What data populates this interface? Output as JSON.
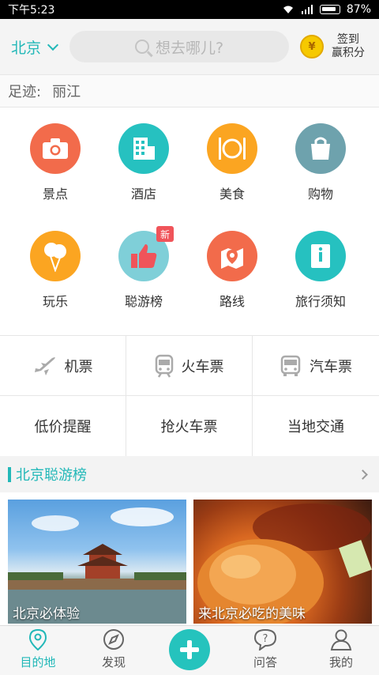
{
  "status_bar": {
    "time": "下午5:23",
    "battery": "87%"
  },
  "header": {
    "city": "北京",
    "search_placeholder": "想去哪儿?",
    "signin_line1": "签到",
    "signin_line2": "赢积分",
    "coin_symbol": "¥"
  },
  "trace": {
    "label": "足迹:",
    "place": "丽江"
  },
  "categories": [
    {
      "label": "景点",
      "color": "#f26b4b",
      "icon": "camera-icon"
    },
    {
      "label": "酒店",
      "color": "#26c1c0",
      "icon": "hotel-icon"
    },
    {
      "label": "美食",
      "color": "#fba521",
      "icon": "food-icon"
    },
    {
      "label": "购物",
      "color": "#6ea2ad",
      "icon": "shopping-bag-icon"
    },
    {
      "label": "玩乐",
      "color": "#fba521",
      "icon": "balloon-icon"
    },
    {
      "label": "聪游榜",
      "color": "#7fcfd8",
      "icon": "thumbs-up-icon",
      "badge": "新"
    },
    {
      "label": "路线",
      "color": "#f26b4b",
      "icon": "map-route-icon"
    },
    {
      "label": "旅行须知",
      "color": "#26c1c0",
      "icon": "info-book-icon"
    }
  ],
  "tickets": [
    {
      "label": "机票",
      "icon": "plane-icon"
    },
    {
      "label": "火车票",
      "icon": "train-icon"
    },
    {
      "label": "汽车票",
      "icon": "bus-icon"
    },
    {
      "label": "低价提醒"
    },
    {
      "label": "抢火车票"
    },
    {
      "label": "当地交通"
    }
  ],
  "section": {
    "title": "北京聪游榜"
  },
  "cards": [
    {
      "caption": "北京必体验"
    },
    {
      "caption": "来北京必吃的美味"
    }
  ],
  "nav": {
    "destination": "目的地",
    "discover": "发现",
    "qa": "问答",
    "mine": "我的"
  },
  "colors": {
    "accent": "#22b8b8"
  }
}
